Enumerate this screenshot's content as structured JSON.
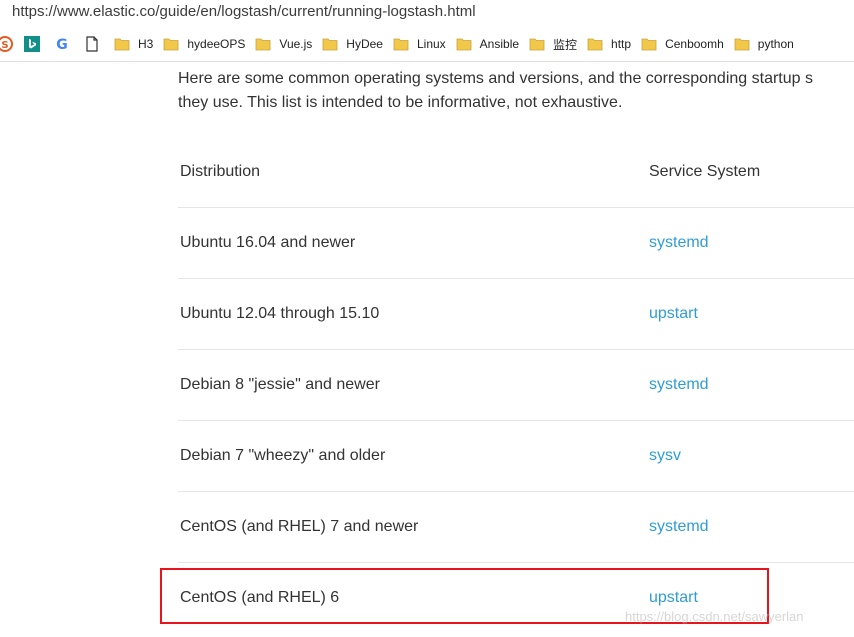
{
  "browser": {
    "url": "https://www.elastic.co/guide/en/logstash/current/running-logstash.html",
    "bookmarks": [
      {
        "label": "H3"
      },
      {
        "label": "hydeeOPS"
      },
      {
        "label": "Vue.js"
      },
      {
        "label": "HyDee"
      },
      {
        "label": "Linux"
      },
      {
        "label": "Ansible"
      },
      {
        "label": "监控"
      },
      {
        "label": "http"
      },
      {
        "label": "Cenboomh"
      },
      {
        "label": "python"
      }
    ],
    "colors": {
      "folder": "#f2c84b",
      "bing": "#138f8a",
      "red_circle": "#e35a24"
    }
  },
  "page": {
    "intro_line1": "Here are some common operating systems and versions, and the corresponding startup s",
    "intro_line2": "they use. This list is intended to be informative, not exhaustive.",
    "table": {
      "headers": {
        "distribution": "Distribution",
        "service": "Service System"
      },
      "rows": [
        {
          "distribution": "Ubuntu 16.04 and newer",
          "service": "systemd"
        },
        {
          "distribution": "Ubuntu 12.04 through 15.10",
          "service": "upstart"
        },
        {
          "distribution": "Debian 8 \"jessie\" and newer",
          "service": "systemd"
        },
        {
          "distribution": "Debian 7 \"wheezy\" and older",
          "service": "sysv"
        },
        {
          "distribution": "CentOS (and RHEL) 7 and newer",
          "service": "systemd"
        },
        {
          "distribution": "CentOS (and RHEL) 6",
          "service": "upstart"
        }
      ]
    },
    "link_color": "#2e9dd6",
    "highlight_color": "#e8141c",
    "watermark": "https://blog.csdn.net/sawyerlan"
  }
}
